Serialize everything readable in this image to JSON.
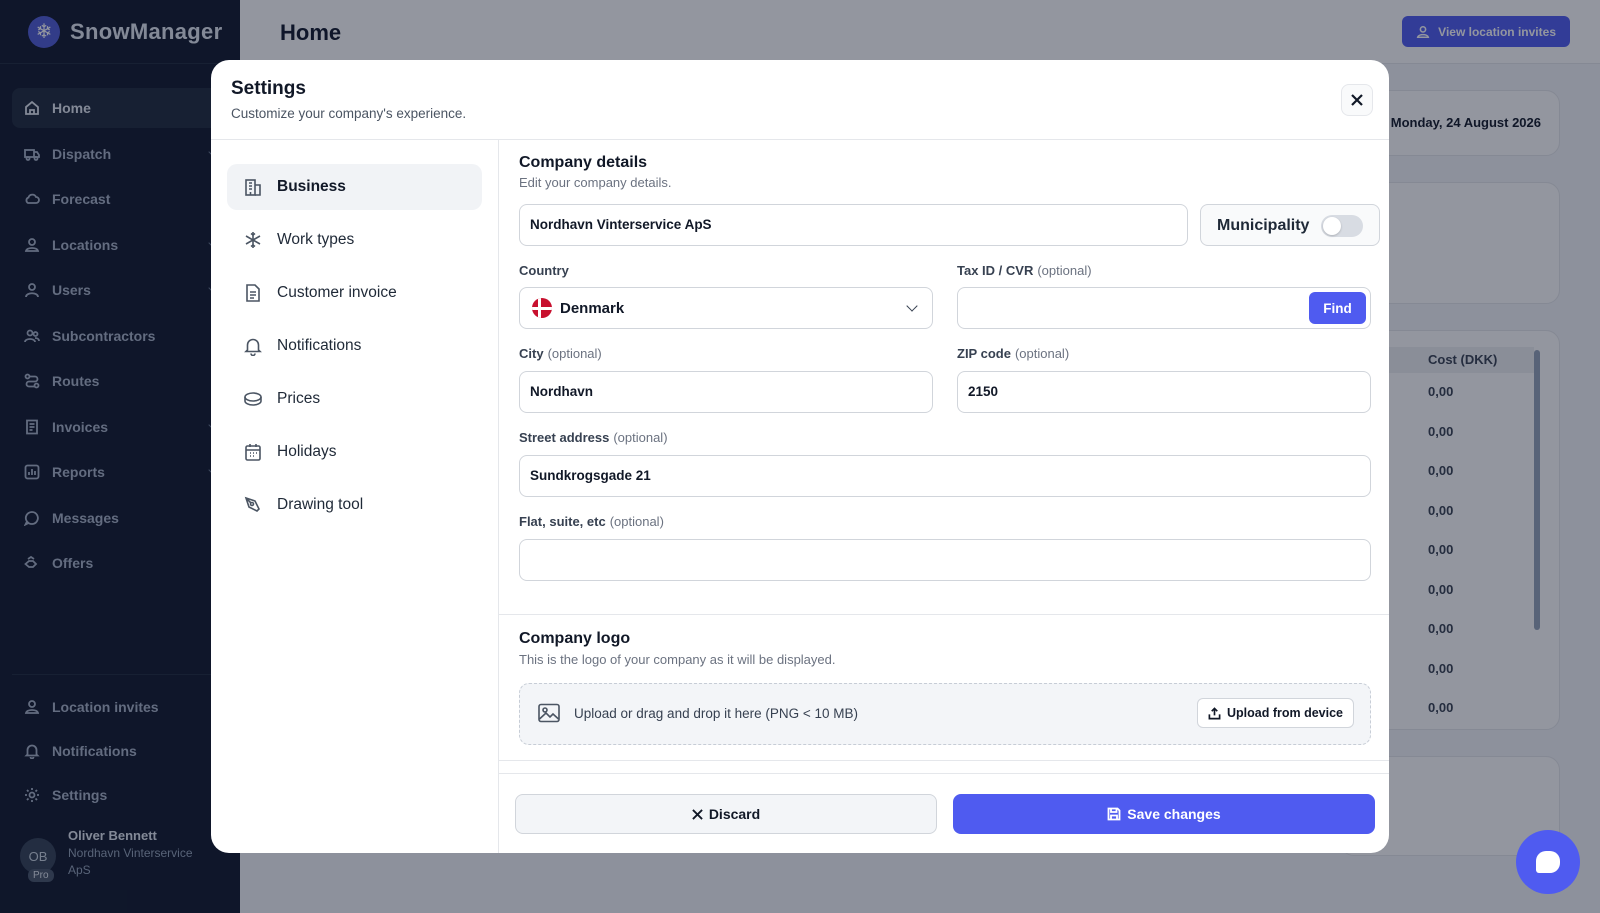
{
  "app": {
    "name": "SnowManager"
  },
  "colors": {
    "accent": "#4f5bf0",
    "sidebar_bg": "#0f172a"
  },
  "sidebar": {
    "items": [
      {
        "label": "Home",
        "icon": "home-icon",
        "active": true
      },
      {
        "label": "Dispatch",
        "icon": "truck-icon",
        "expandable": true
      },
      {
        "label": "Forecast",
        "icon": "cloud-icon"
      },
      {
        "label": "Locations",
        "icon": "location-icon",
        "expandable": true
      },
      {
        "label": "Users",
        "icon": "user-icon",
        "expandable": true
      },
      {
        "label": "Subcontractors",
        "icon": "users-icon"
      },
      {
        "label": "Routes",
        "icon": "route-icon"
      },
      {
        "label": "Invoices",
        "icon": "invoice-icon",
        "expandable": true
      },
      {
        "label": "Reports",
        "icon": "chart-icon",
        "expandable": true
      },
      {
        "label": "Messages",
        "icon": "message-icon"
      },
      {
        "label": "Offers",
        "icon": "offer-icon"
      }
    ],
    "bottom_items": [
      {
        "label": "Location invites",
        "icon": "location-invite-icon"
      },
      {
        "label": "Notifications",
        "icon": "bell-icon"
      },
      {
        "label": "Settings",
        "icon": "gear-icon"
      }
    ],
    "user": {
      "initials": "OB",
      "badge": "Pro",
      "name": "Oliver Bennett",
      "org": "Nordhavn Vinterservice ApS"
    }
  },
  "header": {
    "title": "Home",
    "invites_button": "View location invites"
  },
  "background": {
    "date": "Monday, 24 August 2026",
    "cost_header": "Cost (DKK)",
    "cost_values": [
      "0,00",
      "0,00",
      "0,00",
      "0,00",
      "0,00",
      "0,00",
      "0,00",
      "0,00",
      "0,00"
    ]
  },
  "modal": {
    "title": "Settings",
    "subtitle": "Customize your company's experience.",
    "tabs": [
      {
        "label": "Business",
        "icon": "building-icon",
        "active": true
      },
      {
        "label": "Work types",
        "icon": "snowflake-icon"
      },
      {
        "label": "Customer invoice",
        "icon": "document-icon"
      },
      {
        "label": "Notifications",
        "icon": "bell-icon"
      },
      {
        "label": "Prices",
        "icon": "coins-icon"
      },
      {
        "label": "Holidays",
        "icon": "calendar-icon"
      },
      {
        "label": "Drawing tool",
        "icon": "pen-tool-icon"
      }
    ],
    "company": {
      "title": "Company details",
      "subtitle": "Edit your company details.",
      "name_value": "Nordhavn Vinterservice ApS",
      "municipality_label": "Municipality",
      "municipality_on": false,
      "country_label": "Country",
      "country_value": "Denmark",
      "tax_label": "Tax ID / CVR",
      "tax_value": "",
      "find_button": "Find",
      "city_label": "City",
      "city_value": "Nordhavn",
      "zip_label": "ZIP code",
      "zip_value": "2150",
      "street_label": "Street address",
      "street_value": "Sundkrogsgade 21",
      "flat_label": "Flat, suite, etc",
      "flat_value": "",
      "optional": "(optional)"
    },
    "logo": {
      "title": "Company logo",
      "subtitle": "This is the logo of your company as it will be displayed.",
      "drop_text": "Upload or drag and drop it here (PNG < 10 MB)",
      "upload_button": "Upload from device"
    },
    "footer": {
      "discard": "Discard",
      "save": "Save changes"
    }
  }
}
